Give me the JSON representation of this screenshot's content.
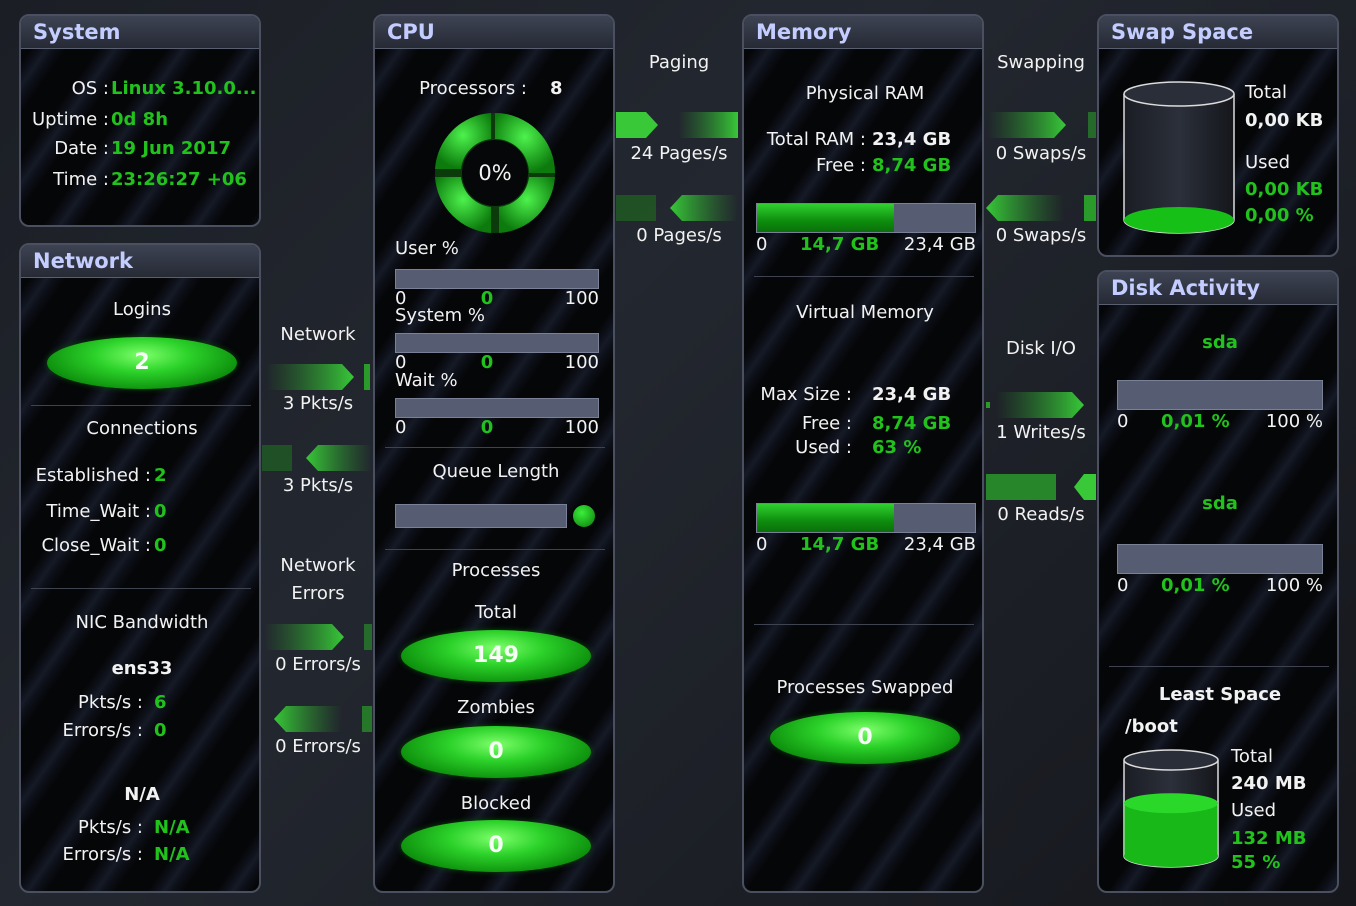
{
  "system": {
    "title": "System",
    "os_label": "OS :",
    "os": "Linux 3.10.0...",
    "uptime_label": "Uptime :",
    "uptime": "0d 8h",
    "date_label": "Date :",
    "date": "19 Jun 2017",
    "time_label": "Time :",
    "time": "23:26:27 +06"
  },
  "network": {
    "title": "Network",
    "logins_label": "Logins",
    "logins": "2",
    "connections_label": "Connections",
    "established_label": "Established :",
    "established": "2",
    "time_wait_label": "Time_Wait :",
    "time_wait": "0",
    "close_wait_label": "Close_Wait :",
    "close_wait": "0",
    "nic_label": "NIC Bandwidth",
    "nic1": {
      "name": "ens33",
      "pkts_label": "Pkts/s :",
      "pkts": "6",
      "errors_label": "Errors/s :",
      "errors": "0"
    },
    "nic2": {
      "name": "N/A",
      "pkts_label": "Pkts/s :",
      "pkts": "N/A",
      "errors_label": "Errors/s :",
      "errors": "N/A"
    }
  },
  "flow_net": {
    "label": "Network",
    "in": "3 Pkts/s",
    "out": "3 Pkts/s",
    "errors_label_1": "Network",
    "errors_label_2": "Errors",
    "err_in": "0 Errors/s",
    "err_out": "0 Errors/s"
  },
  "cpu": {
    "title": "CPU",
    "processors_label": "Processors :",
    "processors": "8",
    "usage": "0%",
    "usage_pct": 0,
    "user": {
      "label": "User %",
      "min": "0",
      "val": "0",
      "max": "100"
    },
    "system": {
      "label": "System %",
      "min": "0",
      "val": "0",
      "max": "100"
    },
    "wait": {
      "label": "Wait %",
      "min": "0",
      "val": "0",
      "max": "100"
    },
    "queue_label": "Queue Length",
    "processes_label": "Processes",
    "total_label": "Total",
    "total": "149",
    "zombies_label": "Zombies",
    "zombies": "0",
    "blocked_label": "Blocked",
    "blocked": "0"
  },
  "flow_paging": {
    "label": "Paging",
    "in": "24 Pages/s",
    "out": "0 Pages/s"
  },
  "memory": {
    "title": "Memory",
    "physical_label": "Physical RAM",
    "total_label": "Total RAM :",
    "total": "23,4 GB",
    "free_label": "Free :",
    "free": "8,74 GB",
    "ram_bar": {
      "min": "0",
      "val": "14,7 GB",
      "max": "23,4 GB",
      "fraction": 0.63
    },
    "virtual_label": "Virtual Memory",
    "max_label": "Max Size :",
    "max": "23,4 GB",
    "vfree_label": "Free :",
    "vfree": "8,74 GB",
    "used_label": "Used :",
    "used": "63 %",
    "vm_bar": {
      "min": "0",
      "val": "14,7 GB",
      "max": "23,4 GB",
      "fraction": 0.63
    },
    "swapped_label": "Processes Swapped",
    "swapped": "0"
  },
  "flow_swap": {
    "label": "Swapping",
    "in": "0 Swaps/s",
    "out": "0 Swaps/s"
  },
  "swap": {
    "title": "Swap Space",
    "total_label": "Total",
    "total": "0,00 KB",
    "used_label": "Used",
    "used": "0,00 KB",
    "used_pct": "0,00 %"
  },
  "flow_disk": {
    "label": "Disk I/O",
    "writes": "1 Writes/s",
    "reads": "0 Reads/s"
  },
  "disk": {
    "title": "Disk Activity",
    "d1": {
      "name": "sda",
      "min": "0",
      "val": "0,01 %",
      "max": "100 %"
    },
    "d2": {
      "name": "sda",
      "min": "0",
      "val": "0,01 %",
      "max": "100 %"
    },
    "least_label": "Least Space",
    "mount": "/boot",
    "total_label": "Total",
    "total": "240 MB",
    "used_label": "Used",
    "used": "132 MB",
    "used_pct": "55 %",
    "used_fraction": 0.55
  },
  "colors": {
    "accent": "#22c21c",
    "header_text": "#c3cdff",
    "bar_bg": "#565c72"
  }
}
